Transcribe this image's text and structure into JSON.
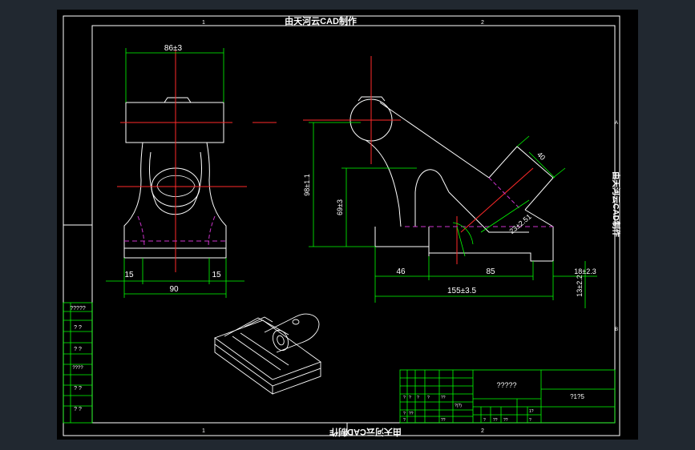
{
  "title_top": "由天河云CAD制作",
  "title_bottom": "由天河云CAD制作",
  "title_side": "由天河云CAD制作",
  "zone_top_left": "1",
  "zone_top_right": "2",
  "zone_bottom_left": "1",
  "zone_bottom_right": "2",
  "zone_right_a": "A",
  "zone_right_b": "B",
  "front_view": {
    "dim_top": "86±3",
    "dim_left_15": "15",
    "dim_right_15": "15",
    "dim_bottom": "90"
  },
  "side_view": {
    "dim_height_large": "98±1.1",
    "dim_height_small": "69±3",
    "dim_46": "46",
    "dim_85": "85",
    "dim_total": "155±3.5",
    "dim_right_width": "18±2.3",
    "dim_right_height": "13±2.2",
    "dim_angle_bore": "40",
    "dim_angle_len": "23±2.51"
  },
  "left_table": [
    "?????",
    "? ?",
    "? ?",
    "????",
    "? ?",
    "? ?"
  ],
  "title_block": {
    "part_name": "?????",
    "drawing_no": "?1?5",
    "small_cells": [
      "?",
      "?",
      "?",
      "?",
      "??",
      "?(?)",
      "?",
      "??",
      "??",
      "?",
      "1?",
      "?",
      "??",
      "?",
      "??"
    ]
  }
}
